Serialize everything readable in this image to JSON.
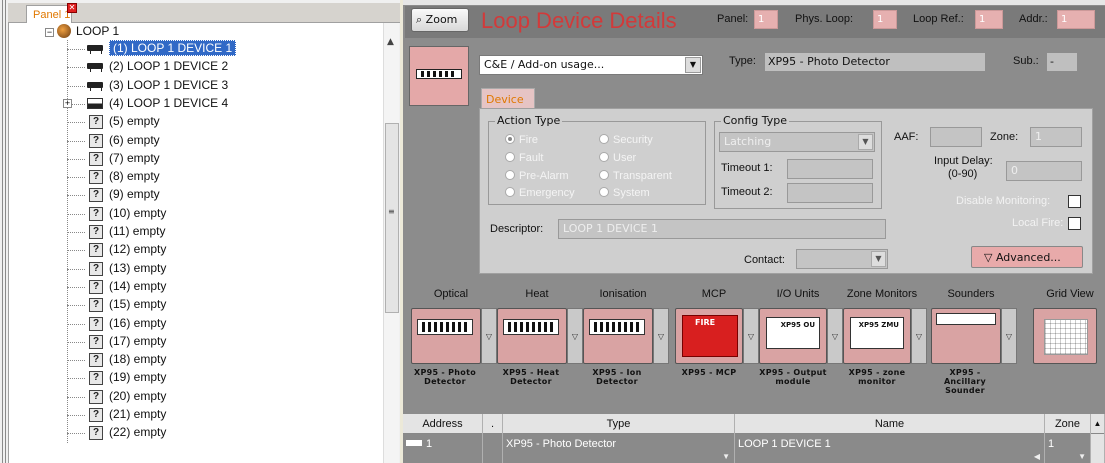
{
  "panel_tab": {
    "label": "Panel 1"
  },
  "tree": {
    "root": "LOOP 1",
    "items": [
      {
        "label": "(1) LOOP 1 DEVICE 1",
        "icon": "detector-icon"
      },
      {
        "label": "(2) LOOP 1 DEVICE 2",
        "icon": "detector-icon"
      },
      {
        "label": "(3) LOOP 1 DEVICE 3",
        "icon": "detector-icon"
      },
      {
        "label": "(4) LOOP 1 DEVICE 4",
        "icon": "module-icon"
      },
      {
        "label": "(5) empty",
        "icon": "unknown-device-icon"
      },
      {
        "label": "(6) empty",
        "icon": "unknown-device-icon"
      },
      {
        "label": "(7) empty",
        "icon": "unknown-device-icon"
      },
      {
        "label": "(8) empty",
        "icon": "unknown-device-icon"
      },
      {
        "label": "(9) empty",
        "icon": "unknown-device-icon"
      },
      {
        "label": "(10) empty",
        "icon": "unknown-device-icon"
      },
      {
        "label": "(11) empty",
        "icon": "unknown-device-icon"
      },
      {
        "label": "(12) empty",
        "icon": "unknown-device-icon"
      },
      {
        "label": "(13) empty",
        "icon": "unknown-device-icon"
      },
      {
        "label": "(14) empty",
        "icon": "unknown-device-icon"
      },
      {
        "label": "(15) empty",
        "icon": "unknown-device-icon"
      },
      {
        "label": "(16) empty",
        "icon": "unknown-device-icon"
      },
      {
        "label": "(17) empty",
        "icon": "unknown-device-icon"
      },
      {
        "label": "(18) empty",
        "icon": "unknown-device-icon"
      },
      {
        "label": "(19) empty",
        "icon": "unknown-device-icon"
      },
      {
        "label": "(20) empty",
        "icon": "unknown-device-icon"
      },
      {
        "label": "(21) empty",
        "icon": "unknown-device-icon"
      },
      {
        "label": "(22) empty",
        "icon": "unknown-device-icon"
      }
    ],
    "question_glyph": "?"
  },
  "header": {
    "zoom_label": "Zoom",
    "title": "Loop Device Details",
    "panel_label": "Panel:",
    "panel_value": "1",
    "phys_loop_label": "Phys. Loop:",
    "phys_loop_value": "1",
    "loop_ref_label": "Loop Ref.:",
    "loop_ref_value": "1",
    "addr_label": "Addr.:",
    "addr_value": "1"
  },
  "usage": {
    "value": "C&E / Add-on usage..."
  },
  "type": {
    "label": "Type:",
    "value": "XP95 - Photo Detector"
  },
  "sub": {
    "label": "Sub.:",
    "value": "-"
  },
  "device_tab": {
    "label": "Device"
  },
  "action_type": {
    "title": "Action Type",
    "options": [
      "Fire",
      "Security",
      "Fault",
      "User",
      "Pre-Alarm",
      "Transparent",
      "Emergency",
      "System"
    ],
    "selected": "Fire"
  },
  "config_type": {
    "title": "Config Type",
    "value": "Latching",
    "timeout1_label": "Timeout 1:",
    "timeout2_label": "Timeout 2:"
  },
  "aaf": {
    "label": "AAF:",
    "value": ""
  },
  "zone": {
    "label": "Zone:",
    "value": "1"
  },
  "input_delay": {
    "label": "Input Delay:",
    "sub_label": "(0-90)",
    "value": "0"
  },
  "disable_monitoring": {
    "label": "Disable Monitoring:"
  },
  "local_fire": {
    "label": "Local Fire:"
  },
  "descriptor": {
    "label": "Descriptor:",
    "value": "LOOP 1 DEVICE 1"
  },
  "contact": {
    "label": "Contact:",
    "value": ""
  },
  "advanced": {
    "label": "Advanced..."
  },
  "categories": [
    {
      "label": "Optical",
      "caption": "XP95 - Photo Detector",
      "icon": "photo-detector-icon"
    },
    {
      "label": "Heat",
      "caption": "XP95 - Heat Detector",
      "icon": "heat-detector-icon"
    },
    {
      "label": "Ionisation",
      "caption": "XP95 - Ion Detector",
      "icon": "ion-detector-icon"
    },
    {
      "label": "MCP",
      "caption": "XP95 - MCP",
      "icon": "call-point-icon",
      "mcp_text": "FIRE"
    },
    {
      "label": "I/O Units",
      "caption": "XP95 - Output module",
      "icon": "output-module-icon",
      "inner_text": "XP95 OU"
    },
    {
      "label": "Zone Monitors",
      "caption": "XP95 - zone monitor",
      "icon": "zone-monitor-icon",
      "inner_text": "XP95 ZMU"
    },
    {
      "label": "Sounders",
      "caption": "XP95 - Ancillary Sounder",
      "icon": "sounder-icon"
    },
    {
      "label": "Grid View",
      "caption": "",
      "icon": "grid-view-icon"
    }
  ],
  "table": {
    "columns": [
      "Address",
      ".",
      "Type",
      "Name",
      "Zone"
    ],
    "rows": [
      {
        "address": "1",
        "type": "XP95 - Photo Detector",
        "name": "LOOP 1 DEVICE 1",
        "zone": "1"
      }
    ]
  }
}
